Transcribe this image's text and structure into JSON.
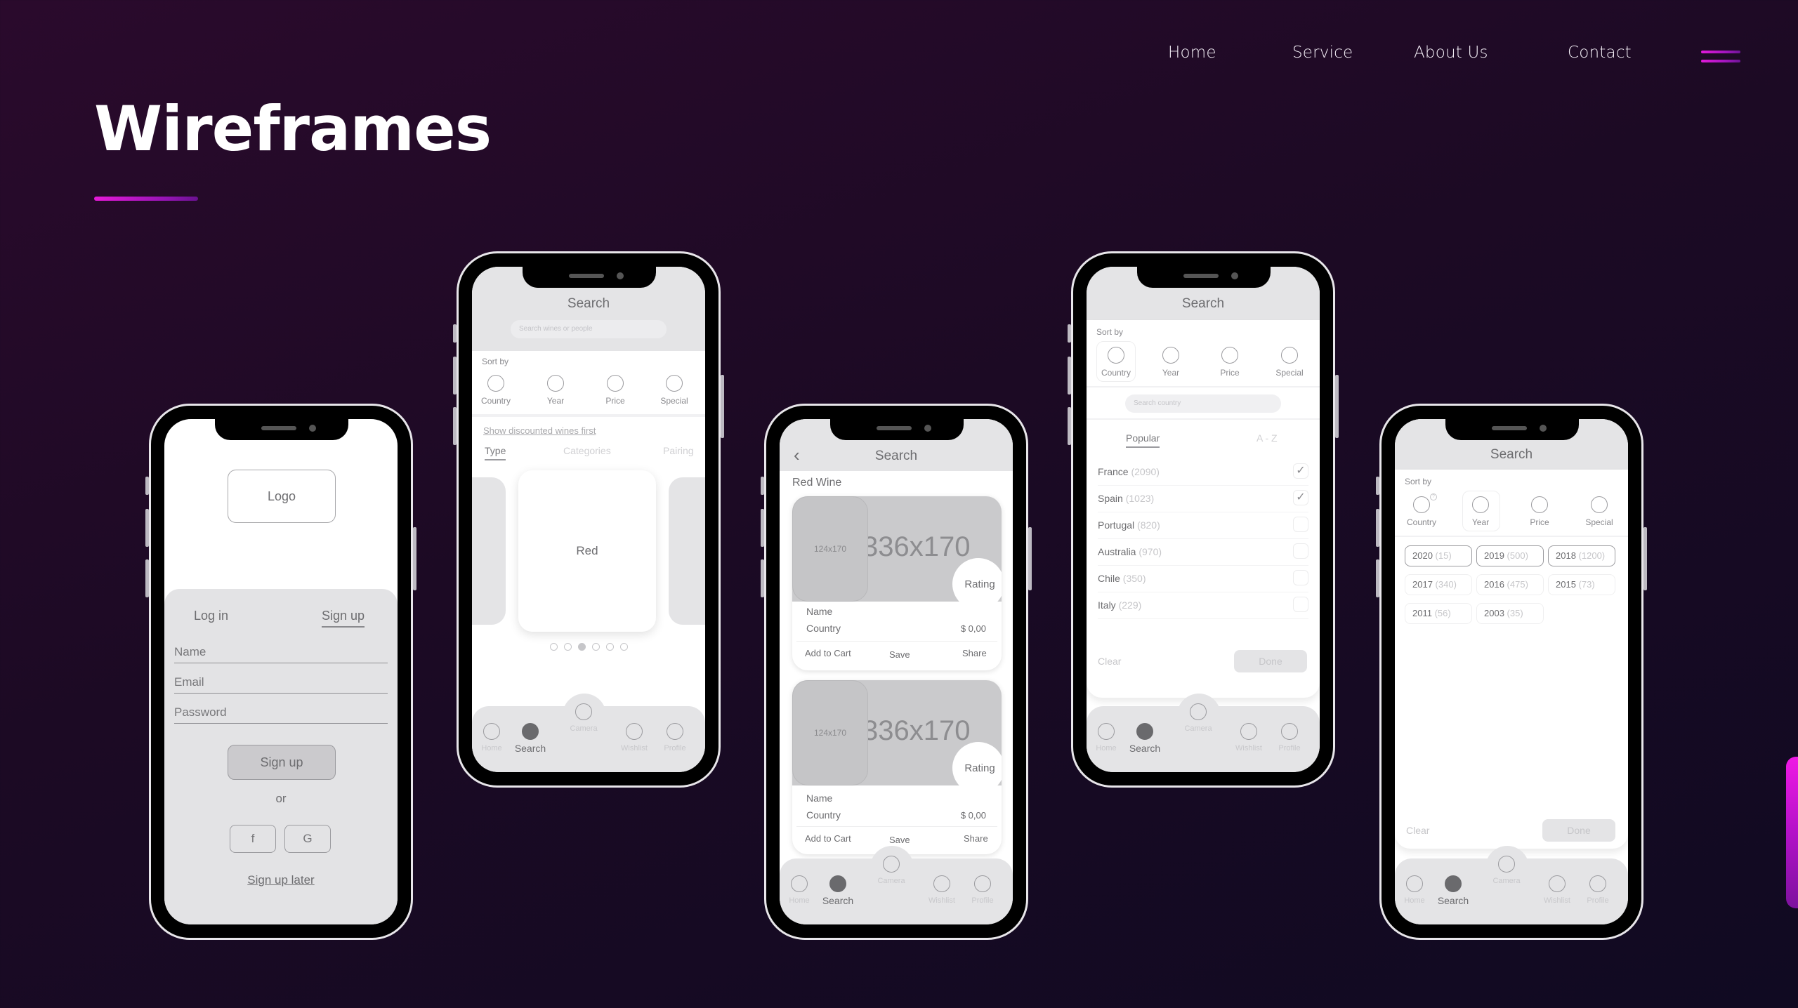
{
  "nav": {
    "links": [
      "Home",
      "Service",
      "About Us",
      "Contact"
    ],
    "menu_icon": "hamburger-menu-icon"
  },
  "page": {
    "title": "Wireframes",
    "accent_color": "#e21ad9",
    "background_color": "#1c0a24"
  },
  "login_screen": {
    "logo_label": "Logo",
    "tabs": [
      "Log in",
      "Sign up"
    ],
    "active_tab": "Sign up",
    "fields": [
      "Name",
      "Email",
      "Password"
    ],
    "submit_label": "Sign up",
    "or_label": "or",
    "social_buttons": [
      "f",
      "G"
    ],
    "later_link": "Sign up later"
  },
  "search_screen": {
    "title": "Search",
    "search_placeholder": "Search wines or people",
    "sort_label": "Sort by",
    "sort_options": [
      "Country",
      "Year",
      "Price",
      "Special"
    ],
    "discount_link": "Show discounted wines first",
    "tabs": [
      "Type",
      "Categories",
      "Pairing"
    ],
    "active_tab": "Type",
    "carousel_card_label": "Red",
    "carousel_pages": 6,
    "carousel_active_page": 3
  },
  "results_screen": {
    "title": "Search",
    "back_icon": "chevron-left-icon",
    "section_title": "Red Wine",
    "products": [
      {
        "thumb": "124x170",
        "image": "336x170",
        "rating": "Rating",
        "name": "Name",
        "country": "Country",
        "price": "$ 0,00",
        "actions": [
          "Add to Cart",
          "Save",
          "Share"
        ]
      },
      {
        "thumb": "124x170",
        "image": "336x170",
        "rating": "Rating",
        "name": "Name",
        "country": "Country",
        "price": "$ 0,00",
        "actions": [
          "Add to Cart",
          "Save",
          "Share"
        ]
      }
    ]
  },
  "country_filter_screen": {
    "title": "Search",
    "sort_label": "Sort by",
    "sort_options": [
      "Country",
      "Year",
      "Price",
      "Special"
    ],
    "selected_sort": "Country",
    "search_placeholder": "Search country",
    "tabs": [
      "Popular",
      "A - Z"
    ],
    "active_tab": "Popular",
    "countries": [
      {
        "name": "France",
        "count": "(2090)",
        "checked": true
      },
      {
        "name": "Spain",
        "count": "(1023)",
        "checked": true
      },
      {
        "name": "Portugal",
        "count": "(820)",
        "checked": false
      },
      {
        "name": "Australia",
        "count": "(970)",
        "checked": false
      },
      {
        "name": "Chile",
        "count": "(350)",
        "checked": false
      },
      {
        "name": "Italy",
        "count": "(229)",
        "checked": false
      }
    ],
    "clear_label": "Clear",
    "done_label": "Done"
  },
  "year_filter_screen": {
    "title": "Search",
    "sort_label": "Sort by",
    "sort_options": [
      "Country",
      "Year",
      "Price",
      "Special"
    ],
    "selected_sort": "Year",
    "info_badge": "?",
    "years": [
      {
        "year": "2020",
        "count": "(15)",
        "selected": true
      },
      {
        "year": "2019",
        "count": "(500)",
        "selected": true
      },
      {
        "year": "2018",
        "count": "(1200)",
        "selected": true
      },
      {
        "year": "2017",
        "count": "(340)",
        "selected": false
      },
      {
        "year": "2016",
        "count": "(475)",
        "selected": false
      },
      {
        "year": "2015",
        "count": "(73)",
        "selected": false
      },
      {
        "year": "2011",
        "count": "(56)",
        "selected": false
      },
      {
        "year": "2003",
        "count": "(35)",
        "selected": false
      }
    ],
    "clear_label": "Clear",
    "done_label": "Done"
  },
  "tabbar": {
    "items": [
      "Home",
      "Search",
      "Camera",
      "Wishlist",
      "Profile"
    ],
    "active": "Search"
  }
}
